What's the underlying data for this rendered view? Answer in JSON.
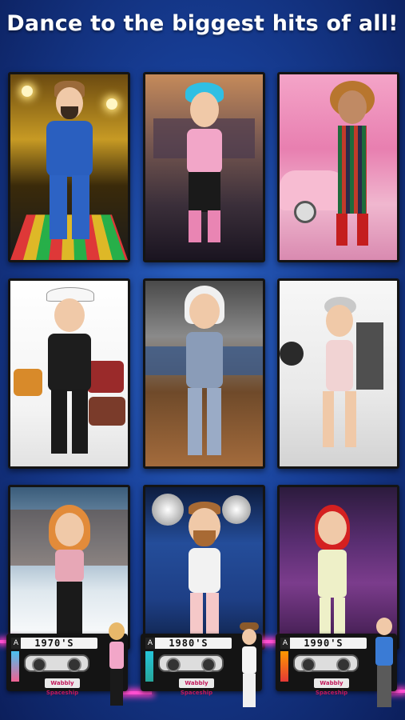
{
  "headline": "Dance to the biggest hits of all!",
  "cassettes": [
    {
      "decade": "1970'S",
      "logo": "Wabbly Spaceship"
    },
    {
      "decade": "1980'S",
      "logo": "Wabbly Spaceship"
    },
    {
      "decade": "1990'S",
      "logo": "Wabbly Spaceship"
    }
  ],
  "cassette_badge": "A",
  "colors": {
    "background": "#173e96",
    "neon": "#ff4fd1",
    "card_border": "#141414"
  }
}
